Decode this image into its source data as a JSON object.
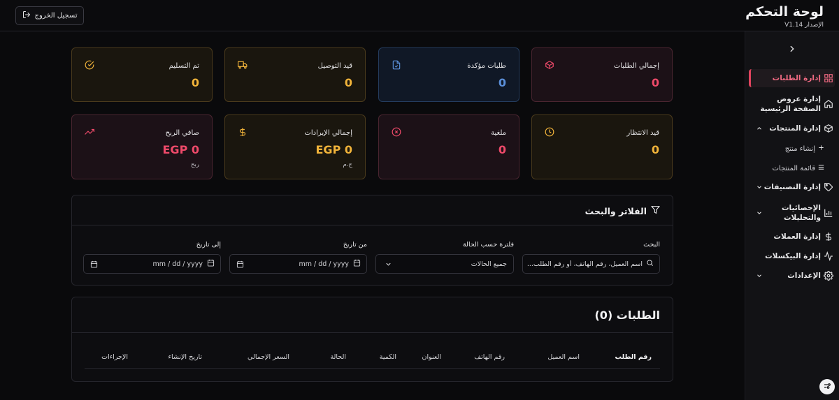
{
  "header": {
    "title": "لوحة التحكم",
    "version": "الإصدار V1.14",
    "logout_label": "تسجيل الخروج"
  },
  "sidebar": {
    "items": [
      {
        "label": "إدارة الطلبات",
        "icon": "grid-icon",
        "active": true
      },
      {
        "label": "إدارة عروض الصفحة الرئيسية",
        "icon": "home-icon"
      },
      {
        "label": "إدارة المنتجات",
        "icon": "box-icon",
        "expanded": true,
        "children": [
          {
            "label": "إنشاء منتج",
            "icon": "plus-icon"
          },
          {
            "label": "قائمة المنتجات",
            "icon": "list-icon"
          }
        ]
      },
      {
        "label": "إدارة التصنيفات",
        "icon": "tag-icon"
      },
      {
        "label": "الإحصائيات والتحليلات",
        "icon": "bar-chart-icon"
      },
      {
        "label": "إدارة العملات",
        "icon": "dollar-icon"
      },
      {
        "label": "إدارة البيكسلات",
        "icon": "activity-icon"
      },
      {
        "label": "الإعدادات",
        "icon": "gear-icon"
      }
    ]
  },
  "stats": [
    {
      "label": "إجمالي الطلبات",
      "value": "0",
      "icon": "package-icon",
      "tone": "red"
    },
    {
      "label": "طلبات مؤكدة",
      "value": "0",
      "icon": "file-check-icon",
      "tone": "blue"
    },
    {
      "label": "قيد التوصيل",
      "value": "0",
      "icon": "truck-icon",
      "tone": "amber"
    },
    {
      "label": "تم التسليم",
      "value": "0",
      "icon": "check-circle-icon",
      "tone": "amber"
    },
    {
      "label": "قيد الانتظار",
      "value": "0",
      "icon": "clock-icon",
      "tone": "amber"
    },
    {
      "label": "ملغية",
      "value": "0",
      "icon": "x-circle-icon",
      "tone": "red"
    },
    {
      "label": "إجمالي الإيرادات",
      "value": "EGP 0",
      "sub": "ج.م",
      "icon": "dollar-icon",
      "tone": "amber"
    },
    {
      "label": "صافي الربح",
      "value": "EGP 0",
      "sub": "ربح",
      "icon": "trending-up-icon",
      "tone": "red"
    }
  ],
  "filters": {
    "title": "الفلاتر والبحث",
    "search_label": "البحث",
    "search_placeholder": "اسم العميل، رقم الهاتف، أو رقم الطلب...",
    "status_label": "فلترة حسب الحالة",
    "status_value": "جميع الحالات",
    "from_label": "من تاريخ",
    "from_value": "mm / dd / yyyy",
    "to_label": "إلى تاريخ",
    "to_value": "mm / dd / yyyy"
  },
  "orders": {
    "title": "الطلبات (0)",
    "columns": [
      "رقم الطلب",
      "اسم العميل",
      "رقم الهاتف",
      "العنوان",
      "الكمية",
      "الحالة",
      "السعر الإجمالي",
      "تاريخ الإنشاء",
      "الإجراءات"
    ]
  },
  "colors": {
    "accent_red": "#ef4a6a",
    "accent_blue": "#5b8fd9",
    "accent_amber": "#f2b43a",
    "background": "#0a0a0c"
  }
}
